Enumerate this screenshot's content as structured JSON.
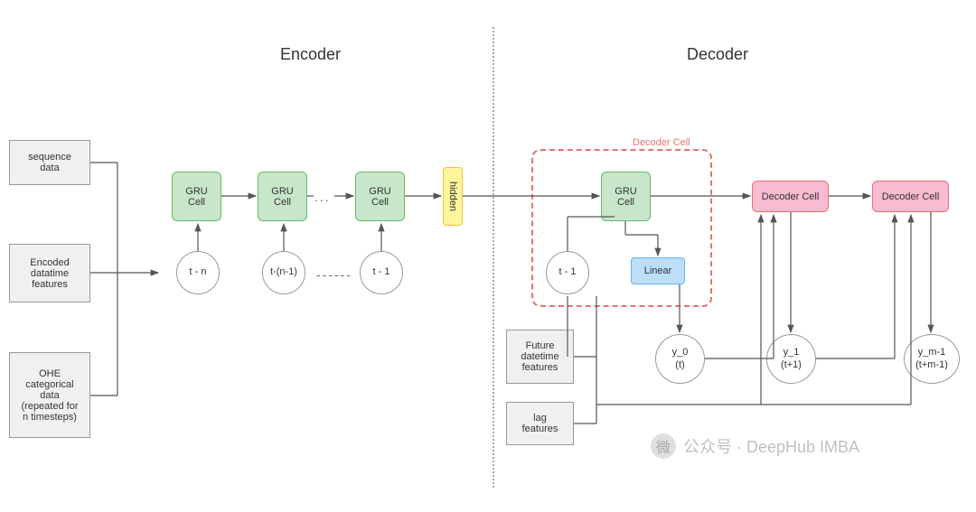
{
  "titles": {
    "encoder": "Encoder",
    "decoder": "Decoder"
  },
  "encoder_inputs": {
    "sequence": "sequence\ndata",
    "datetime": "Encoded\ndatatime\nfeatures",
    "categorical": "OHE\ncategorical\ndata\n(repeated for\nn timesteps)"
  },
  "gru": {
    "label": "GRU\nCell"
  },
  "timesteps": {
    "t_n": "t - n",
    "t_n1": "t-(n-1)",
    "t_1": "t - 1",
    "dots": "------"
  },
  "hidden": {
    "label": "hidden"
  },
  "decoder": {
    "outline_label": "Decoder Cell",
    "linear": "Linear",
    "cell_label": "Decoder Cell",
    "future_features": "Future\ndatetime\nfeatures",
    "lag_features": "lag\nfeatures",
    "y0": "y_0\n(t)",
    "y1": "y_1\n(t+1)",
    "ym": "y_m-1\n(t+m-1)"
  },
  "watermark": {
    "icon": "微",
    "text": "公众号 · DeepHub IMBA"
  },
  "ellipsis": "..."
}
